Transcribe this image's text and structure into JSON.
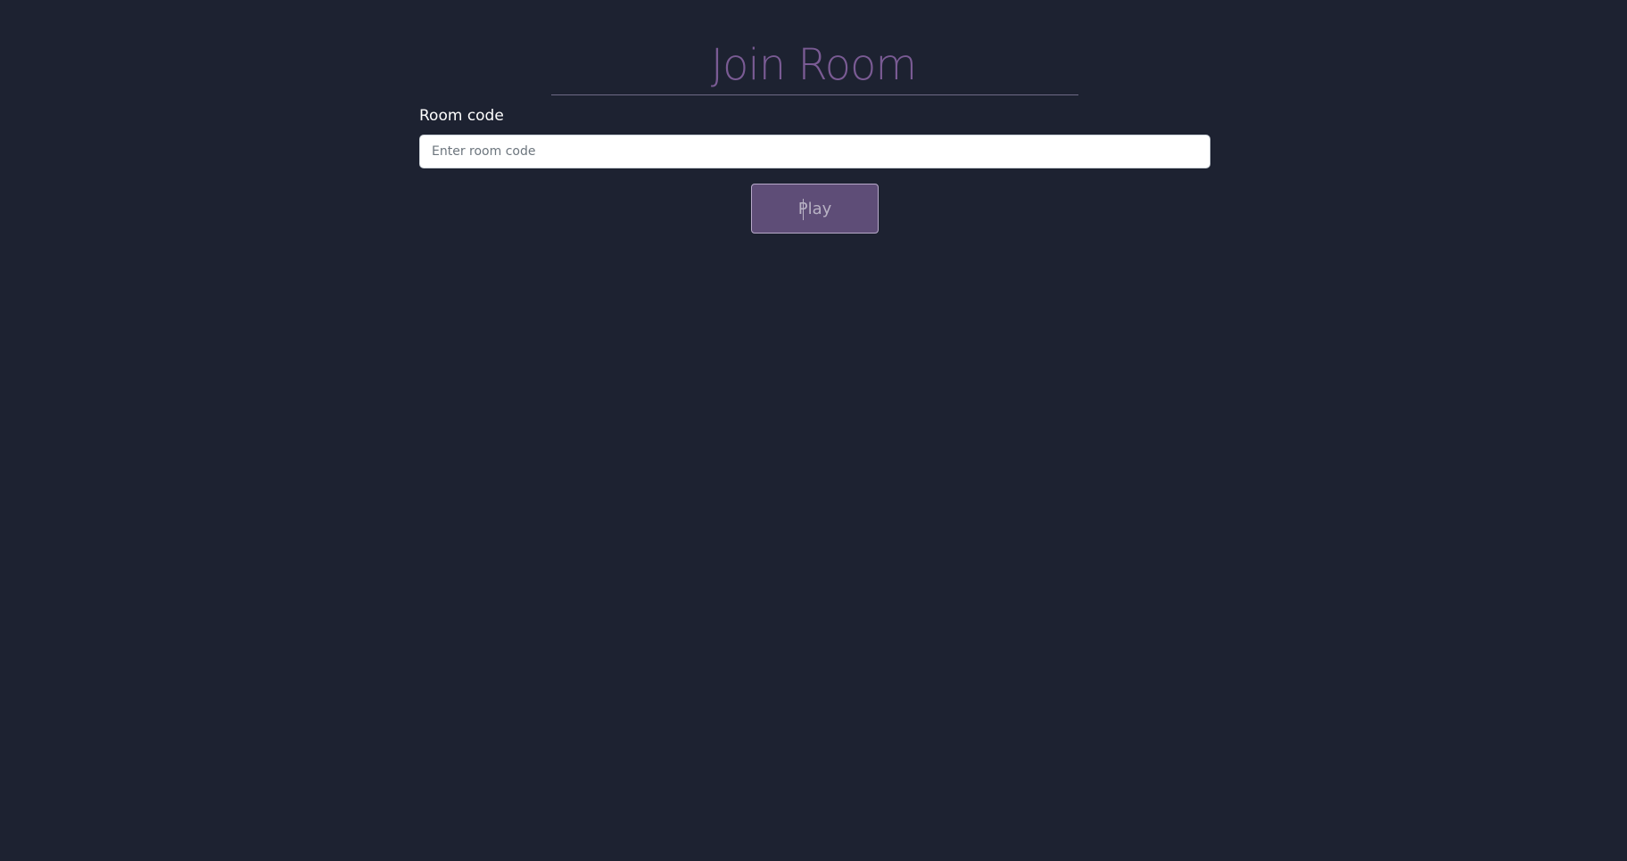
{
  "page": {
    "title": "Join Room"
  },
  "form": {
    "room_code_label": "Room code",
    "room_code_placeholder": "Enter room code",
    "room_code_value": "",
    "play_label": "Play"
  },
  "colors": {
    "background": "#1d2231",
    "title": "#7a5b94",
    "button": "#5e4d77"
  }
}
